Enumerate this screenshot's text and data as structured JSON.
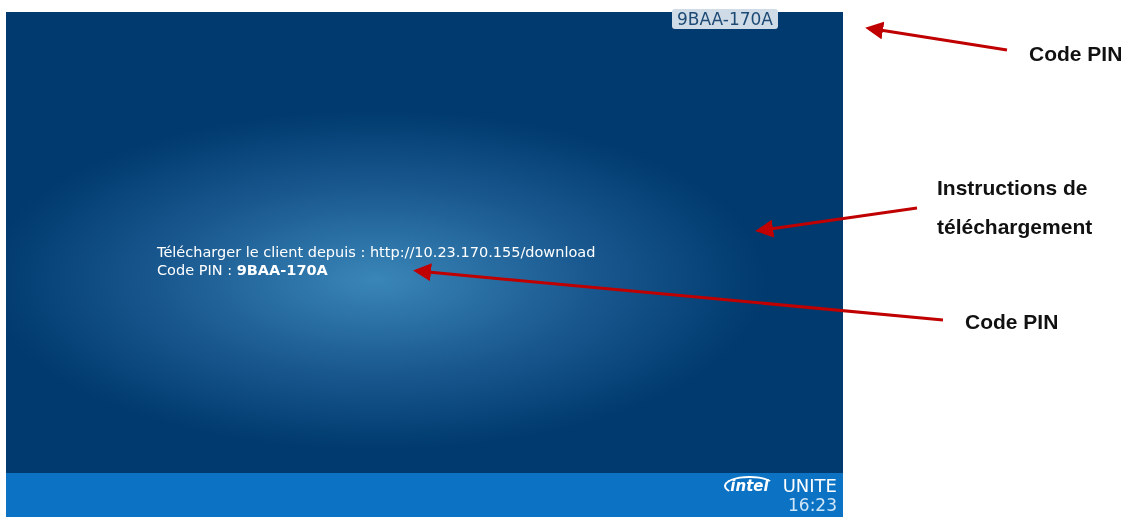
{
  "screen": {
    "pin_badge": "9BAA-170A",
    "download_instruction": "Télécharger le client depuis : http://10.23.170.155/download",
    "pin_line": "Code PIN : **9BAA-170A**",
    "footer": {
      "logo_text": "intel",
      "product_name": "UNITE",
      "time": "16:23"
    }
  },
  "annotations": [
    {
      "text": "Code PIN"
    },
    {
      "text": "Instructions de téléchargement"
    },
    {
      "text": "Code PIN"
    }
  ]
}
